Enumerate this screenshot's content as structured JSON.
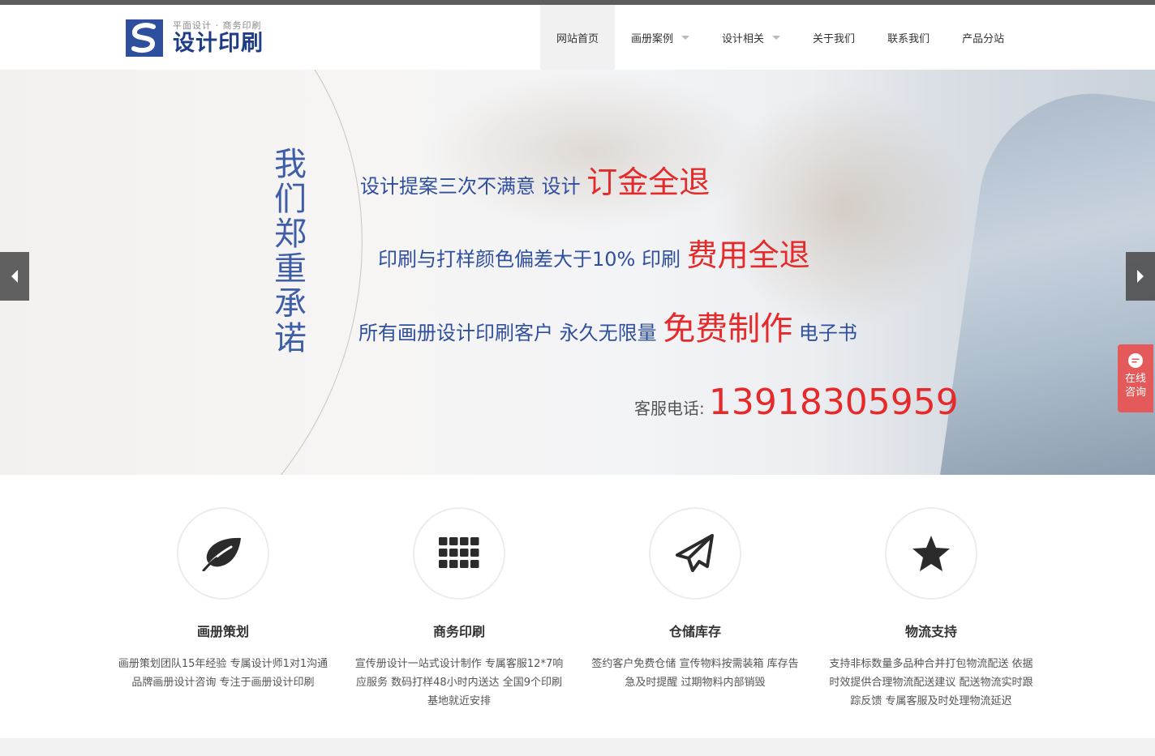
{
  "header": {
    "logo_subtitle": "平面设计 · 商务印刷",
    "logo_title": "设计印刷",
    "nav": [
      {
        "label": "网站首页",
        "active": true,
        "has_dropdown": false
      },
      {
        "label": "画册案例",
        "active": false,
        "has_dropdown": true
      },
      {
        "label": "设计相关",
        "active": false,
        "has_dropdown": true
      },
      {
        "label": "关于我们",
        "active": false,
        "has_dropdown": false
      },
      {
        "label": "联系我们",
        "active": false,
        "has_dropdown": false
      },
      {
        "label": "产品分站",
        "active": false,
        "has_dropdown": false
      }
    ]
  },
  "banner": {
    "vertical_title": "我们郑重承诺",
    "line1": {
      "text": "设计提案三次不满意 设计 ",
      "highlight": "订金全退"
    },
    "line2": {
      "text": "印刷与打样颜色偏差大于10% 印刷 ",
      "highlight": "费用全退"
    },
    "line3": {
      "text": "所有画册设计印刷客户 永久无限量 ",
      "highlight": "免费制作",
      "suffix": " 电子书"
    },
    "hotline_label": "客服电话:",
    "hotline_number": "13918305959",
    "prev_icon": "chevron-left-icon",
    "next_icon": "chevron-right-icon"
  },
  "chat_widget": {
    "label": "在线咨询",
    "icon": "chat-bubble-icon"
  },
  "features": [
    {
      "icon": "leaf-icon",
      "title": "画册策划",
      "desc": "画册策划团队15年经验 专属设计师1对1沟通 品牌画册设计咨询 专注于画册设计印刷"
    },
    {
      "icon": "grid-icon",
      "title": "商务印刷",
      "desc": "宣传册设计一站式设计制作 专属客服12*7响应服务 数码打样48小时内送达 全国9个印刷基地就近安排"
    },
    {
      "icon": "paper-plane-icon",
      "title": "仓储库存",
      "desc": "签约客户免费仓储 宣传物料按需装箱 库存告急及时提醒 过期物料内部销毁"
    },
    {
      "icon": "star-icon",
      "title": "物流支持",
      "desc": "支持非标数量多品种合并打包物流配送 依据时效提供合理物流配送建议 配送物流实时跟踪反馈 专属客服及时处理物流延迟"
    }
  ],
  "colors": {
    "brand_blue": "#2d4f9e",
    "accent_red": "#e42a2a",
    "chat_red": "#e45a5a"
  }
}
